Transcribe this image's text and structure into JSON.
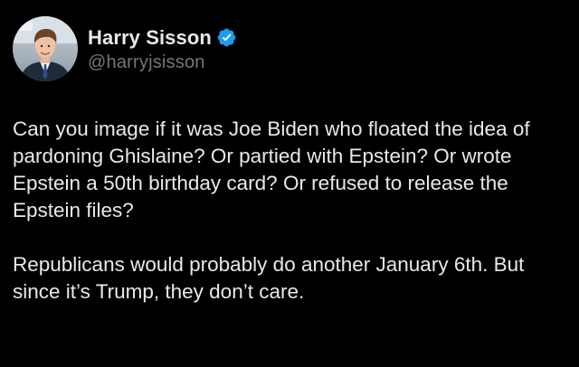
{
  "tweet": {
    "author": {
      "display_name": "Harry Sisson",
      "handle": "@harryjsisson",
      "verified": true,
      "avatar_icon": "profile-photo"
    },
    "paragraphs": [
      "Can you image if it was Joe Biden who floated the idea of pardoning Ghislaine? Or partied with Epstein? Or wrote Epstein a 50th birthday card? Or refused to release the Epstein files?",
      "Republicans would probably do another January 6th. But since it’s Trump, they don’t care."
    ]
  },
  "colors": {
    "background": "#000000",
    "text": "#e7e9ea",
    "secondary_text": "#71767b",
    "verified_badge": "#1d9bf0"
  }
}
